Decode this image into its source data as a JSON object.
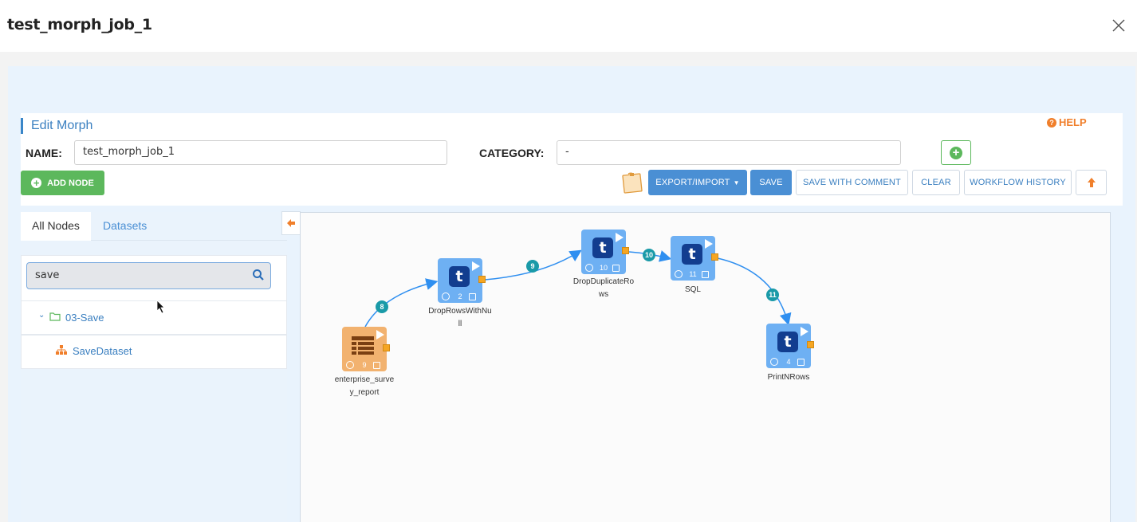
{
  "modal": {
    "title": "test_morph_job_1"
  },
  "edit": {
    "section_title": "Edit Morph",
    "help_label": "HELP",
    "name_label": "NAME:",
    "name_value": "test_morph_job_1",
    "category_label": "CATEGORY:",
    "category_value": "-"
  },
  "toolbar": {
    "add_node": "ADD NODE",
    "export_import": "EXPORT/IMPORT",
    "save": "SAVE",
    "save_with_comment": "SAVE WITH COMMENT",
    "clear": "CLEAR",
    "workflow_history": "WORKFLOW HISTORY"
  },
  "sidebar": {
    "tabs": [
      "All Nodes",
      "Datasets"
    ],
    "search_value": "save",
    "tree": {
      "folder": "03-Save",
      "item": "SaveDataset"
    }
  },
  "workflow": {
    "nodes": [
      {
        "id": "n9",
        "label_line1": "enterprise_surve",
        "label_line2": "y_report",
        "number": "9",
        "kind": "dataset"
      },
      {
        "id": "n2",
        "label_line1": "DropRowsWithNu",
        "label_line2": "ll",
        "number": "2",
        "kind": "transform"
      },
      {
        "id": "n10",
        "label_line1": "DropDuplicateRo",
        "label_line2": "ws",
        "number": "10",
        "kind": "transform"
      },
      {
        "id": "n11",
        "label_line1": "SQL",
        "label_line2": "",
        "number": "11",
        "kind": "transform"
      },
      {
        "id": "n4",
        "label_line1": "PrintNRows",
        "label_line2": "",
        "number": "4",
        "kind": "transform"
      }
    ],
    "edges": [
      "8",
      "9",
      "10",
      "11"
    ]
  },
  "colors": {
    "accent": "#4a8fd4",
    "green": "#5cb85c",
    "orange": "#f07f2b",
    "teal": "#1a9aa8",
    "node_blue": "#6eb0f3",
    "node_orange": "#f2b26f"
  }
}
